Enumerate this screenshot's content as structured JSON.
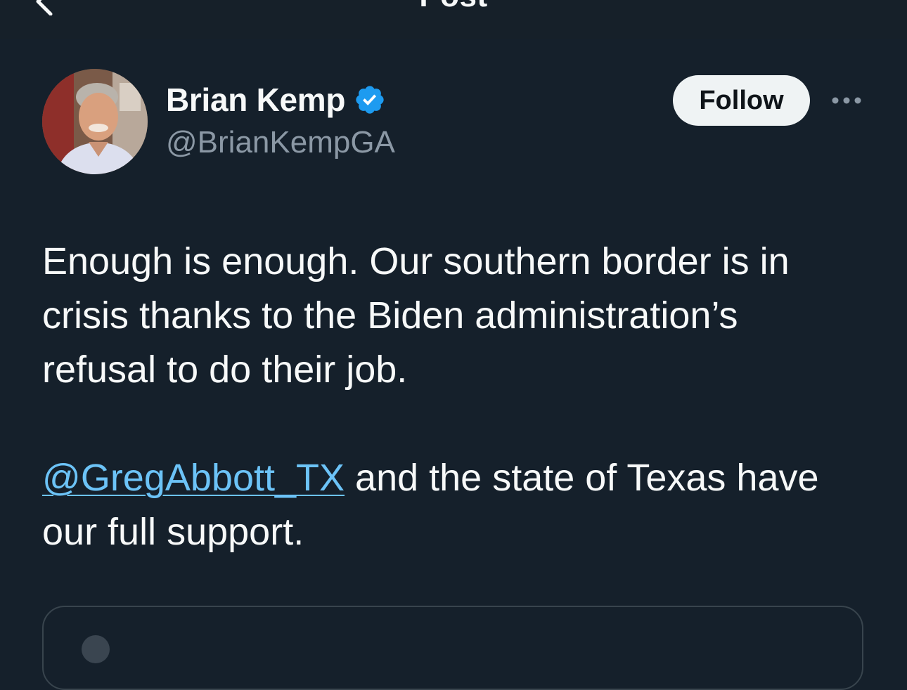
{
  "header": {
    "title": "Post",
    "back_icon": "arrow-left-icon"
  },
  "author": {
    "name": "Brian Kemp",
    "handle": "@BrianKempGA",
    "verified_icon": "verified-badge-icon",
    "verified_color": "#1d9bf0"
  },
  "actions": {
    "follow_label": "Follow",
    "more_icon": "more-horizontal-icon"
  },
  "tweet": {
    "line1": "Enough is enough. Our southern border is in",
    "line2": "crisis thanks to the Biden administration’s",
    "line3": "refusal to do their job.",
    "mention": "@GregAbbott_TX",
    "mention_rest": " and the state of Texas have",
    "line5": "our full support."
  },
  "colors": {
    "background": "#15202b",
    "text": "#f7f9f9",
    "secondary_text": "#8b98a5",
    "link": "#6cc3f7",
    "border": "#38444d"
  }
}
